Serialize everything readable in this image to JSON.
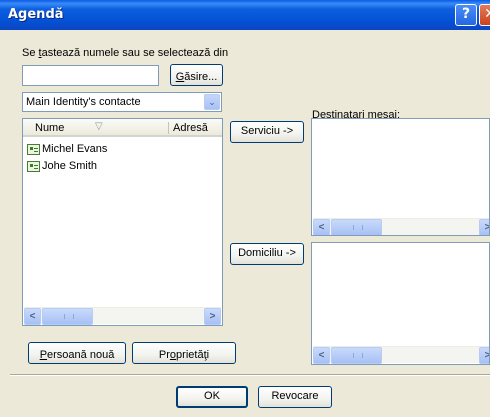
{
  "window": {
    "title": "Agendă",
    "help_label": "?",
    "close_label": "✕"
  },
  "search": {
    "prompt_prefix": "Se ",
    "prompt_key": "t",
    "prompt_suffix": "astează numele sau se selectează din",
    "value": "",
    "find_key": "G",
    "find_rest": "ăsire..."
  },
  "source": {
    "selected": "Main Identity's contacte",
    "arrow": "⌄"
  },
  "contacts": {
    "columns": [
      "Nume",
      "Adresă"
    ],
    "sort_indicator": "▽",
    "rows": [
      {
        "name": "Michel Evans"
      },
      {
        "name": "Johe Smith"
      }
    ]
  },
  "buttons": {
    "serviciu": "Serviciu ->",
    "domiciliu": "Domiciliu ->",
    "new_contact_key": "P",
    "new_contact_rest": "ersoană nouă",
    "properties_pre": "Pr",
    "properties_key": "o",
    "properties_rest": "prietăţi",
    "ok": "OK",
    "cancel": "Revocare"
  },
  "recipients": {
    "label_pre": "Destinatari ",
    "label_key": "m",
    "label_rest": "esaj:"
  },
  "scroll": {
    "left": "<",
    "right": ">"
  }
}
